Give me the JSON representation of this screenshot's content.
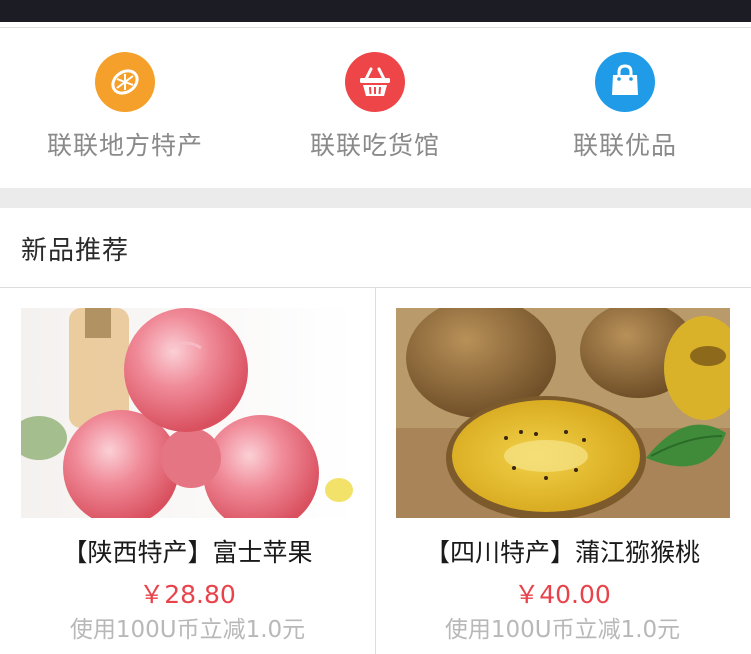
{
  "categories": [
    {
      "label": "联联地方特产",
      "icon": "lemon-icon",
      "color": "#f5a02a"
    },
    {
      "label": "联联吃货馆",
      "icon": "basket-icon",
      "color": "#ee4648"
    },
    {
      "label": "联联优品",
      "icon": "shopping-bag-icon",
      "color": "#1f9be8"
    }
  ],
  "section": {
    "title": "新品推荐"
  },
  "products": [
    {
      "name": "【陕西特产】富士苹果",
      "price": "￥28.80",
      "promo": "使用100U币立减1.0元",
      "image": "apples-photo"
    },
    {
      "name": "【四川特产】蒲江猕猴桃",
      "price": "￥40.00",
      "promo": "使用100U币立减1.0元",
      "image": "kiwi-photo"
    }
  ],
  "colors": {
    "price": "#e8434a",
    "divider": "#ebebeb"
  }
}
